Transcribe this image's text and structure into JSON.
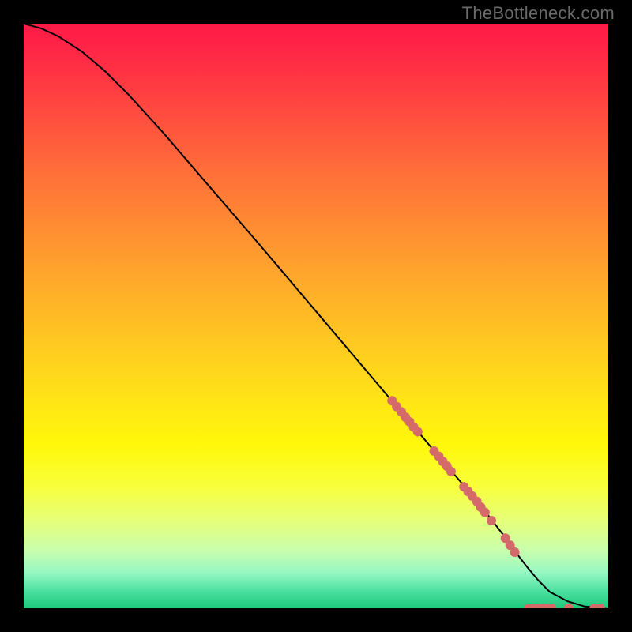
{
  "attribution": "TheBottleneck.com",
  "chart_data": {
    "type": "line",
    "title": "",
    "xlabel": "",
    "ylabel": "",
    "xlim": [
      0,
      100
    ],
    "ylim": [
      0,
      100
    ],
    "series": [
      {
        "name": "curve",
        "x": [
          0,
          3,
          6,
          10,
          14,
          18,
          24,
          30,
          40,
          50,
          60,
          70,
          78,
          82,
          84,
          86,
          88,
          90,
          93,
          96,
          100
        ],
        "y": [
          100,
          99.2,
          97.8,
          95.2,
          91.8,
          87.8,
          81.2,
          74.2,
          62.6,
          50.8,
          39.0,
          27.2,
          17.8,
          12.6,
          9.8,
          7.2,
          4.8,
          2.8,
          1.2,
          0.3,
          0
        ]
      }
    ],
    "markers": [
      {
        "x": 63.0,
        "y": 35.5
      },
      {
        "x": 63.8,
        "y": 34.5
      },
      {
        "x": 64.6,
        "y": 33.6
      },
      {
        "x": 65.3,
        "y": 32.7
      },
      {
        "x": 66.0,
        "y": 31.9
      },
      {
        "x": 66.7,
        "y": 31.0
      },
      {
        "x": 67.4,
        "y": 30.2
      },
      {
        "x": 70.2,
        "y": 26.9
      },
      {
        "x": 71.0,
        "y": 26.0
      },
      {
        "x": 71.7,
        "y": 25.1
      },
      {
        "x": 72.4,
        "y": 24.3
      },
      {
        "x": 73.1,
        "y": 23.4
      },
      {
        "x": 75.3,
        "y": 20.8
      },
      {
        "x": 76.0,
        "y": 20.0
      },
      {
        "x": 76.7,
        "y": 19.2
      },
      {
        "x": 77.5,
        "y": 18.3
      },
      {
        "x": 78.2,
        "y": 17.3
      },
      {
        "x": 78.9,
        "y": 16.4
      },
      {
        "x": 80.0,
        "y": 15.0
      },
      {
        "x": 82.4,
        "y": 12.0
      },
      {
        "x": 83.2,
        "y": 10.8
      },
      {
        "x": 84.0,
        "y": 9.6
      },
      {
        "x": 86.4,
        "y": 0.0
      },
      {
        "x": 87.1,
        "y": 0.0
      },
      {
        "x": 87.9,
        "y": 0.0
      },
      {
        "x": 88.8,
        "y": 0.0
      },
      {
        "x": 89.6,
        "y": 0.0
      },
      {
        "x": 90.3,
        "y": 0.0
      },
      {
        "x": 93.2,
        "y": 0.0
      },
      {
        "x": 97.6,
        "y": 0.0
      },
      {
        "x": 98.6,
        "y": 0.0
      }
    ],
    "marker_color": "#d46a6a",
    "marker_radius_px": 6
  }
}
